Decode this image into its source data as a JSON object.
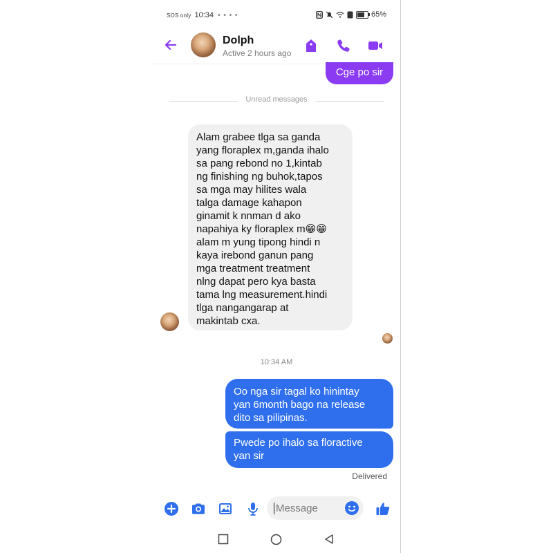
{
  "status": {
    "sos": "SOS only",
    "time": "10:34",
    "notif_dots": "• • • •",
    "battery": "65%",
    "battery_level": 0.65
  },
  "header": {
    "name": "Dolph",
    "status": "Active 2 hours ago"
  },
  "thread": {
    "prev_outgoing": "Cge po sir",
    "unread_divider": "Unread messages",
    "incoming": {
      "text": "Alam grabee tlga sa ganda\nyang floraplex m,ganda ihalo\nsa pang rebond no 1,kintab\nng finishing ng buhok,tapos\nsa mga may hilites wala\ntalga damage kahapon\nginamit k nnman d ako\nnapahiya ky floraplex m😁😁\nalam m yung tipong hindi n\nkaya irebond ganun pang\nmga treatment treatment\nnlng dapat pero kya basta\ntama lng measurement.hindi\ntlga nangangarap at\nmakintab cxa."
    },
    "timestamp": "10:34 AM",
    "outgoing": [
      {
        "text": "Oo nga sir tagal ko hinintay\nyan 6month bago na release\ndito sa pilipinas."
      },
      {
        "text": "Pwede po ihalo sa floractive\nyan sir"
      }
    ],
    "delivered": "Delivered"
  },
  "composer": {
    "placeholder": "Message"
  },
  "colors": {
    "accent_purple": "#8b3cf2",
    "outgoing_blue": "#2f6fed",
    "incoming_grey": "#f0f0f0",
    "composer_icon_blue": "#2f6fed"
  },
  "icons": {
    "back": "arrow-left-icon",
    "header": [
      "tag-icon",
      "phone-icon",
      "video-camera-icon"
    ],
    "composer": [
      "plus-circle-icon",
      "camera-icon",
      "image-icon",
      "microphone-icon",
      "emoji-icon",
      "thumbs-up-icon"
    ],
    "nav": [
      "recent-apps-square-icon",
      "home-circle-icon",
      "back-triangle-icon"
    ]
  }
}
